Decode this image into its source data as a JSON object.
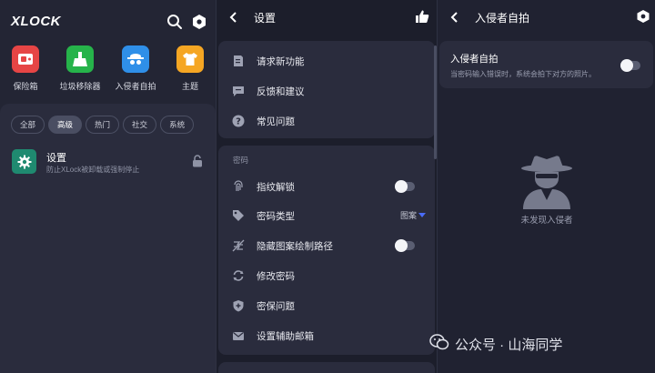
{
  "home": {
    "logo": "XLOCK",
    "apps": [
      {
        "label": "保险箱",
        "color": "#e64545"
      },
      {
        "label": "垃圾移除器",
        "color": "#26b34a"
      },
      {
        "label": "入侵者自拍",
        "color": "#2f8fe8"
      },
      {
        "label": "主题",
        "color": "#f5a623"
      }
    ],
    "chips": [
      "全部",
      "高级",
      "热门",
      "社交",
      "系统"
    ],
    "active_chip": "高级",
    "setting": {
      "title": "设置",
      "subtitle": "防止XLock被卸载或强制停止"
    }
  },
  "settings": {
    "title": "设置",
    "help_items": [
      {
        "label": "请求新功能",
        "icon": "edit-note-icon"
      },
      {
        "label": "反馈和建议",
        "icon": "chat-icon"
      },
      {
        "label": "常见问题",
        "icon": "help-icon"
      }
    ],
    "password_section": "密码",
    "password_items": [
      {
        "label": "指纹解锁",
        "icon": "fingerprint-icon",
        "toggle": false
      },
      {
        "label": "密码类型",
        "icon": "tag-icon",
        "value": "图案"
      },
      {
        "label": "隐藏图案绘制路径",
        "icon": "hide-path-icon",
        "toggle": false
      },
      {
        "label": "修改密码",
        "icon": "refresh-icon"
      },
      {
        "label": "密保问题",
        "icon": "shield-plus-icon"
      },
      {
        "label": "设置辅助邮箱",
        "icon": "mail-icon"
      }
    ]
  },
  "intruder": {
    "title": "入侵者自拍",
    "card_title": "入侵者自拍",
    "card_desc": "当密码输入错误时，系统会拍下对方的照片。",
    "enabled": false,
    "empty_text": "未发现入侵者"
  },
  "watermark": "公众号 · 山海同学"
}
